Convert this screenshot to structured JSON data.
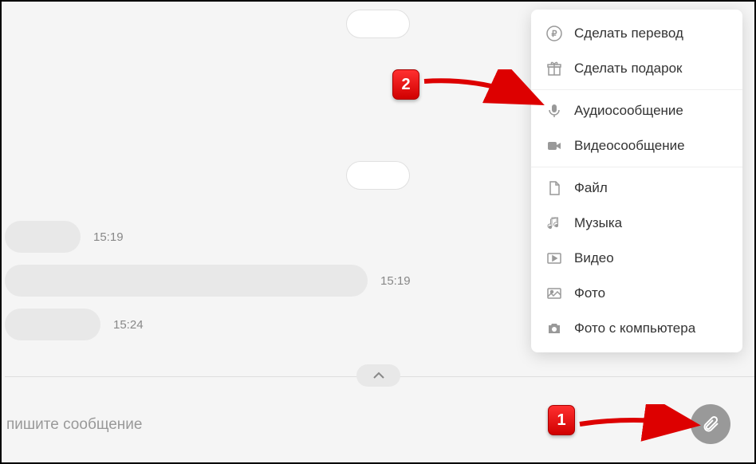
{
  "messages": {
    "timestamps": [
      "15:19",
      "15:19",
      "15:24"
    ]
  },
  "compose": {
    "placeholder": "пишите сообщение"
  },
  "menu": {
    "items": [
      {
        "label": "Сделать перевод",
        "icon": "ruble-icon"
      },
      {
        "label": "Сделать подарок",
        "icon": "gift-icon"
      },
      {
        "label": "Аудиосообщение",
        "icon": "mic-icon"
      },
      {
        "label": "Видеосообщение",
        "icon": "videocam-icon"
      },
      {
        "label": "Файл",
        "icon": "file-icon"
      },
      {
        "label": "Музыка",
        "icon": "music-icon"
      },
      {
        "label": "Видео",
        "icon": "video-icon"
      },
      {
        "label": "Фото",
        "icon": "photo-icon"
      },
      {
        "label": "Фото с компьютера",
        "icon": "camera-icon"
      }
    ]
  },
  "annotations": {
    "badge1": "1",
    "badge2": "2"
  }
}
